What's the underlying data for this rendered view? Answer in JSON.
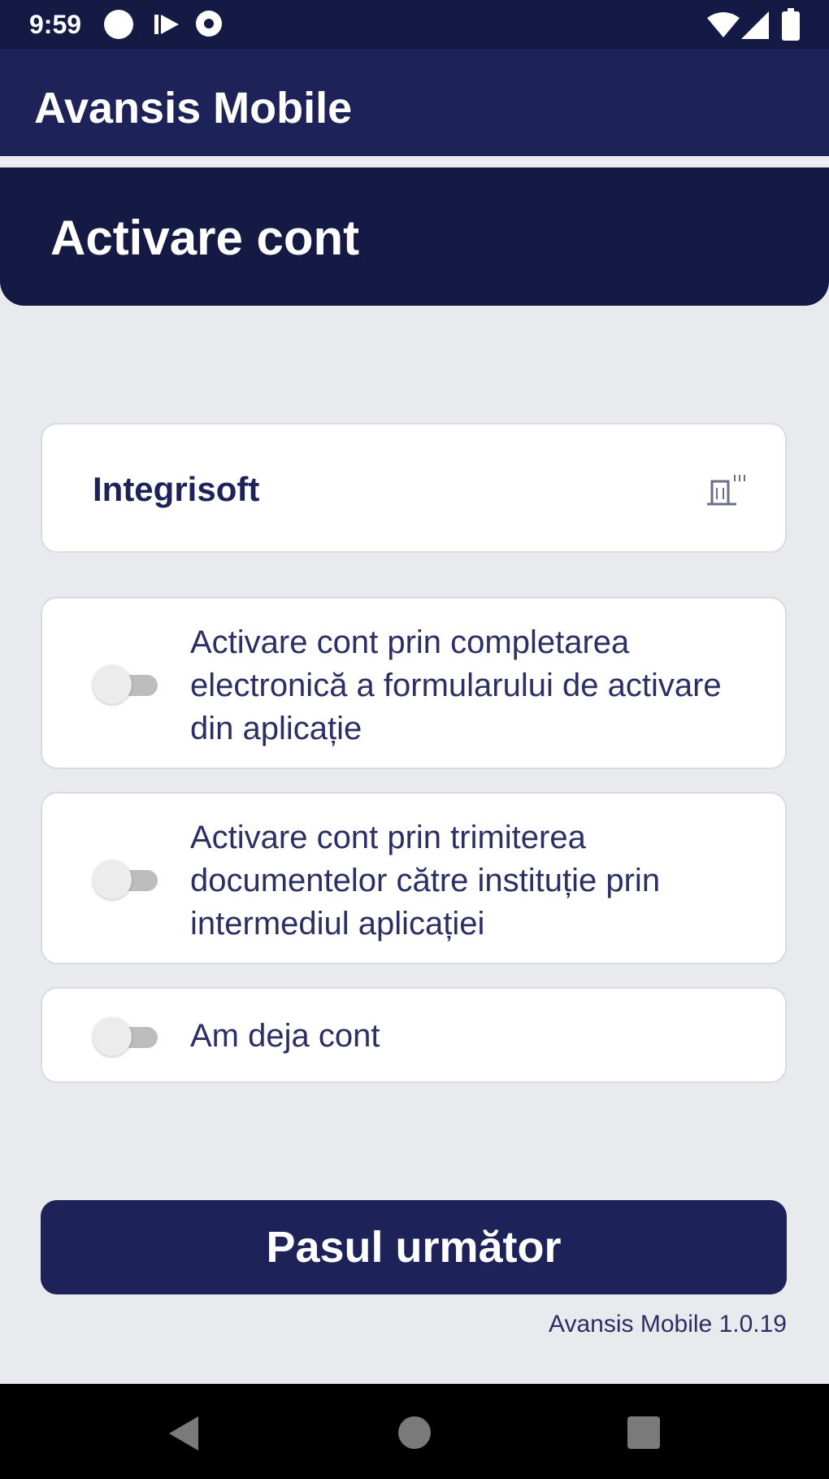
{
  "status_bar": {
    "time": "9:59",
    "icons": [
      "circle-notification-icon",
      "play-store-icon",
      "settings-notification-icon",
      "wifi-icon",
      "signal-icon",
      "battery-icon"
    ]
  },
  "app_bar": {
    "title": "Avansis Mobile"
  },
  "header": {
    "title": "Activare cont"
  },
  "institution": {
    "name": "Integrisoft",
    "icon": "building-icon"
  },
  "options": [
    {
      "label": "Activare cont prin completarea electronică a formularului de activare din aplicație",
      "enabled": false
    },
    {
      "label": "Activare cont prin trimiterea documentelor către instituție prin intermediul aplicației",
      "enabled": false
    },
    {
      "label": "Am deja cont",
      "enabled": false
    }
  ],
  "next_button": {
    "label": "Pasul următor"
  },
  "footer": {
    "version": "Avansis Mobile 1.0.19"
  },
  "colors": {
    "primary": "#1d2358",
    "header_dark": "#151a44",
    "background": "#e9eaee",
    "text": "#2b2f63"
  },
  "nav_bar": {
    "icons": [
      "back-icon",
      "home-icon",
      "recents-icon"
    ]
  }
}
